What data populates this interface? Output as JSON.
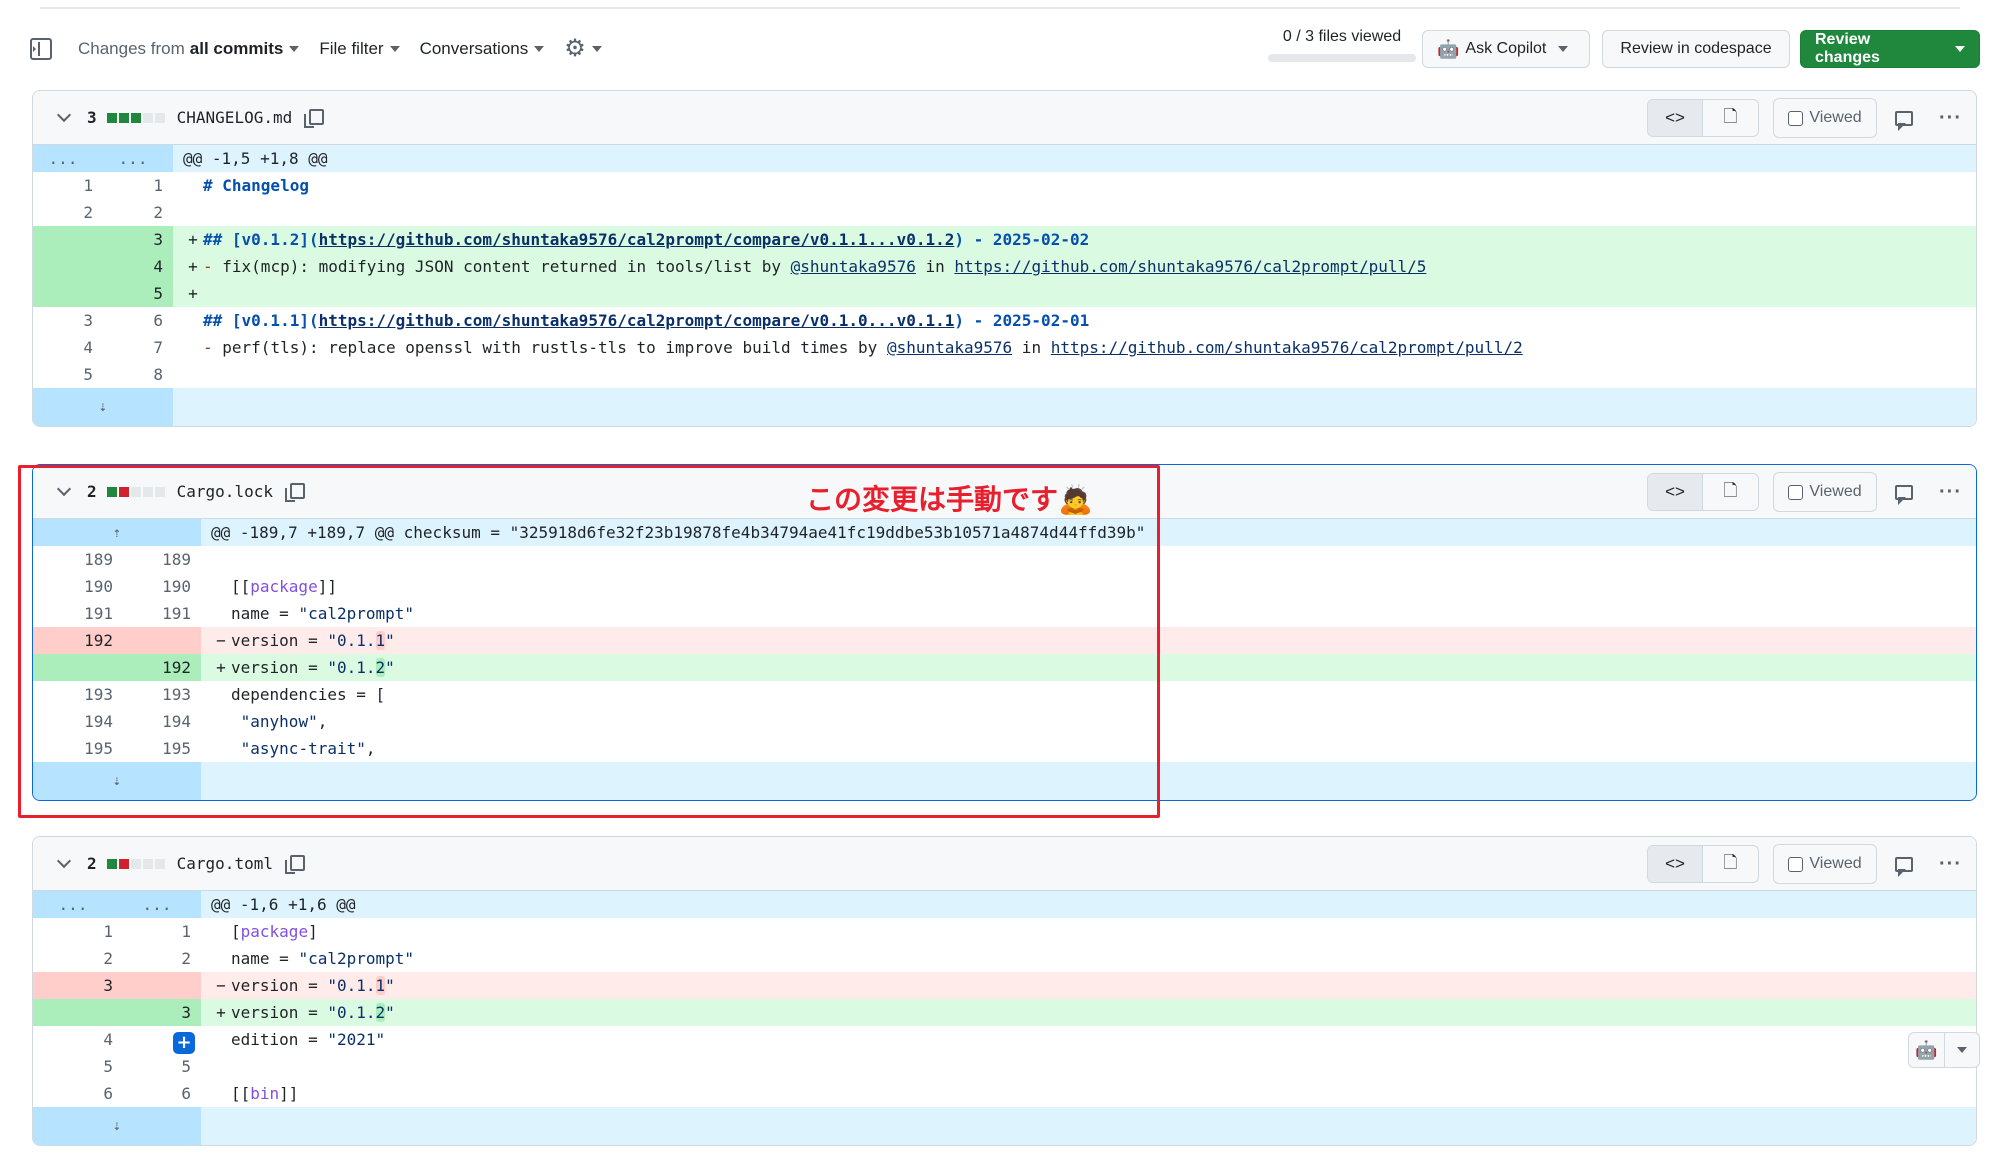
{
  "toolbar": {
    "changes_prefix": "Changes from",
    "changes_value": "all commits",
    "file_filter": "File filter",
    "conversations": "Conversations",
    "settings_icon": "gear-icon",
    "files_viewed": "0 / 3 files viewed",
    "files_viewed_progress": 0,
    "ask_copilot": "Ask Copilot",
    "review_codespace": "Review in codespace",
    "review_changes": "Review changes"
  },
  "file_header_labels": {
    "viewed": "Viewed",
    "code_view_icon": "<>",
    "file_icon": "file-icon"
  },
  "annotation": {
    "text": "この変更は手動です",
    "emoji": "🙇"
  },
  "files": [
    {
      "name": "CHANGELOG.md",
      "count": "3",
      "diffstat": [
        "g",
        "g",
        "g",
        "n",
        "n"
      ],
      "hunk": "@@ -1,5 +1,8 @@",
      "rows": [
        {
          "type": "ctx",
          "old": "1",
          "new": "1",
          "html": "<span class='kw-h'># Changelog</span>"
        },
        {
          "type": "ctx",
          "old": "2",
          "new": "2",
          "html": ""
        },
        {
          "type": "add",
          "old": "",
          "new": "3",
          "html": "<span class='kw-h'>## [v0.1.2](<span class='lnk'>https://github.com/shuntaka9576/cal2prompt/compare/v0.1.1...v0.1.2</span>) - 2025-02-02</span>"
        },
        {
          "type": "add",
          "old": "",
          "new": "4",
          "html": "<span class='dash'>-</span> fix(mcp): modifying JSON content returned in tools/list by <span class='lnk'>@shuntaka9576</span> in <span class='lnk'>https://github.com/shuntaka9576/cal2prompt/pull/5</span>"
        },
        {
          "type": "add",
          "old": "",
          "new": "5",
          "html": ""
        },
        {
          "type": "ctx",
          "old": "3",
          "new": "6",
          "html": "<span class='kw-h'>## [v0.1.1](<span class='lnk'>https://github.com/shuntaka9576/cal2prompt/compare/v0.1.0...v0.1.1</span>) - 2025-02-01</span>"
        },
        {
          "type": "ctx",
          "old": "4",
          "new": "7",
          "html": "<span class='dash'>-</span> perf(tls): replace openssl with rustls-tls to improve build times by <span class='lnk'>@shuntaka9576</span> in <span class='lnk'>https://github.com/shuntaka9576/cal2prompt/pull/2</span>"
        },
        {
          "type": "ctx",
          "old": "5",
          "new": "8",
          "html": ""
        }
      ]
    },
    {
      "name": "Cargo.lock",
      "count": "2",
      "diffstat": [
        "g",
        "r",
        "n",
        "n",
        "n"
      ],
      "hunk": "@@ -189,7 +189,7 @@ checksum = \"325918d6fe32f23b19878fe4b34794ae41fc19ddbe53b10571a4874d44ffd39b\"",
      "rows": [
        {
          "type": "ctx",
          "old": "189",
          "new": "189",
          "html": ""
        },
        {
          "type": "ctx",
          "old": "190",
          "new": "190",
          "html": "[[<span class='pkg'>package</span>]]"
        },
        {
          "type": "ctx",
          "old": "191",
          "new": "191",
          "html": "name = <span class='str'>\"cal2prompt\"</span>"
        },
        {
          "type": "del",
          "old": "192",
          "new": "",
          "html": "version = <span class='str'>\"0.1.<span class='hl-del'>1</span>\"</span>"
        },
        {
          "type": "add",
          "old": "",
          "new": "192",
          "html": "version = <span class='str'>\"0.1.<span class='hl-add'>2</span>\"</span>"
        },
        {
          "type": "ctx",
          "old": "193",
          "new": "193",
          "html": "dependencies = ["
        },
        {
          "type": "ctx",
          "old": "194",
          "new": "194",
          "html": " <span class='str'>\"anyhow\"</span>,"
        },
        {
          "type": "ctx",
          "old": "195",
          "new": "195",
          "html": " <span class='str'>\"async-trait\"</span>,"
        }
      ]
    },
    {
      "name": "Cargo.toml",
      "count": "2",
      "diffstat": [
        "g",
        "r",
        "n",
        "n",
        "n"
      ],
      "hunk": "@@ -1,6 +1,6 @@",
      "rows": [
        {
          "type": "ctx",
          "old": "1",
          "new": "1",
          "html": "[<span class='pkg'>package</span>]"
        },
        {
          "type": "ctx",
          "old": "2",
          "new": "2",
          "html": "name = <span class='str'>\"cal2prompt\"</span>"
        },
        {
          "type": "del",
          "old": "3",
          "new": "",
          "html": "version = <span class='str'>\"0.1.<span class='hl-del'>1</span>\"</span>"
        },
        {
          "type": "add",
          "old": "",
          "new": "3",
          "html": "version = <span class='str'>\"0.1.<span class='hl-add'>2</span>\"</span>"
        },
        {
          "type": "ctx",
          "old": "4",
          "new": "4",
          "html": "edition = <span class='str'>\"2021\"</span>",
          "plus": true
        },
        {
          "type": "ctx",
          "old": "5",
          "new": "5",
          "html": ""
        },
        {
          "type": "ctx",
          "old": "6",
          "new": "6",
          "html": "[[<span class='pkg'>bin</span>]]"
        }
      ]
    }
  ]
}
